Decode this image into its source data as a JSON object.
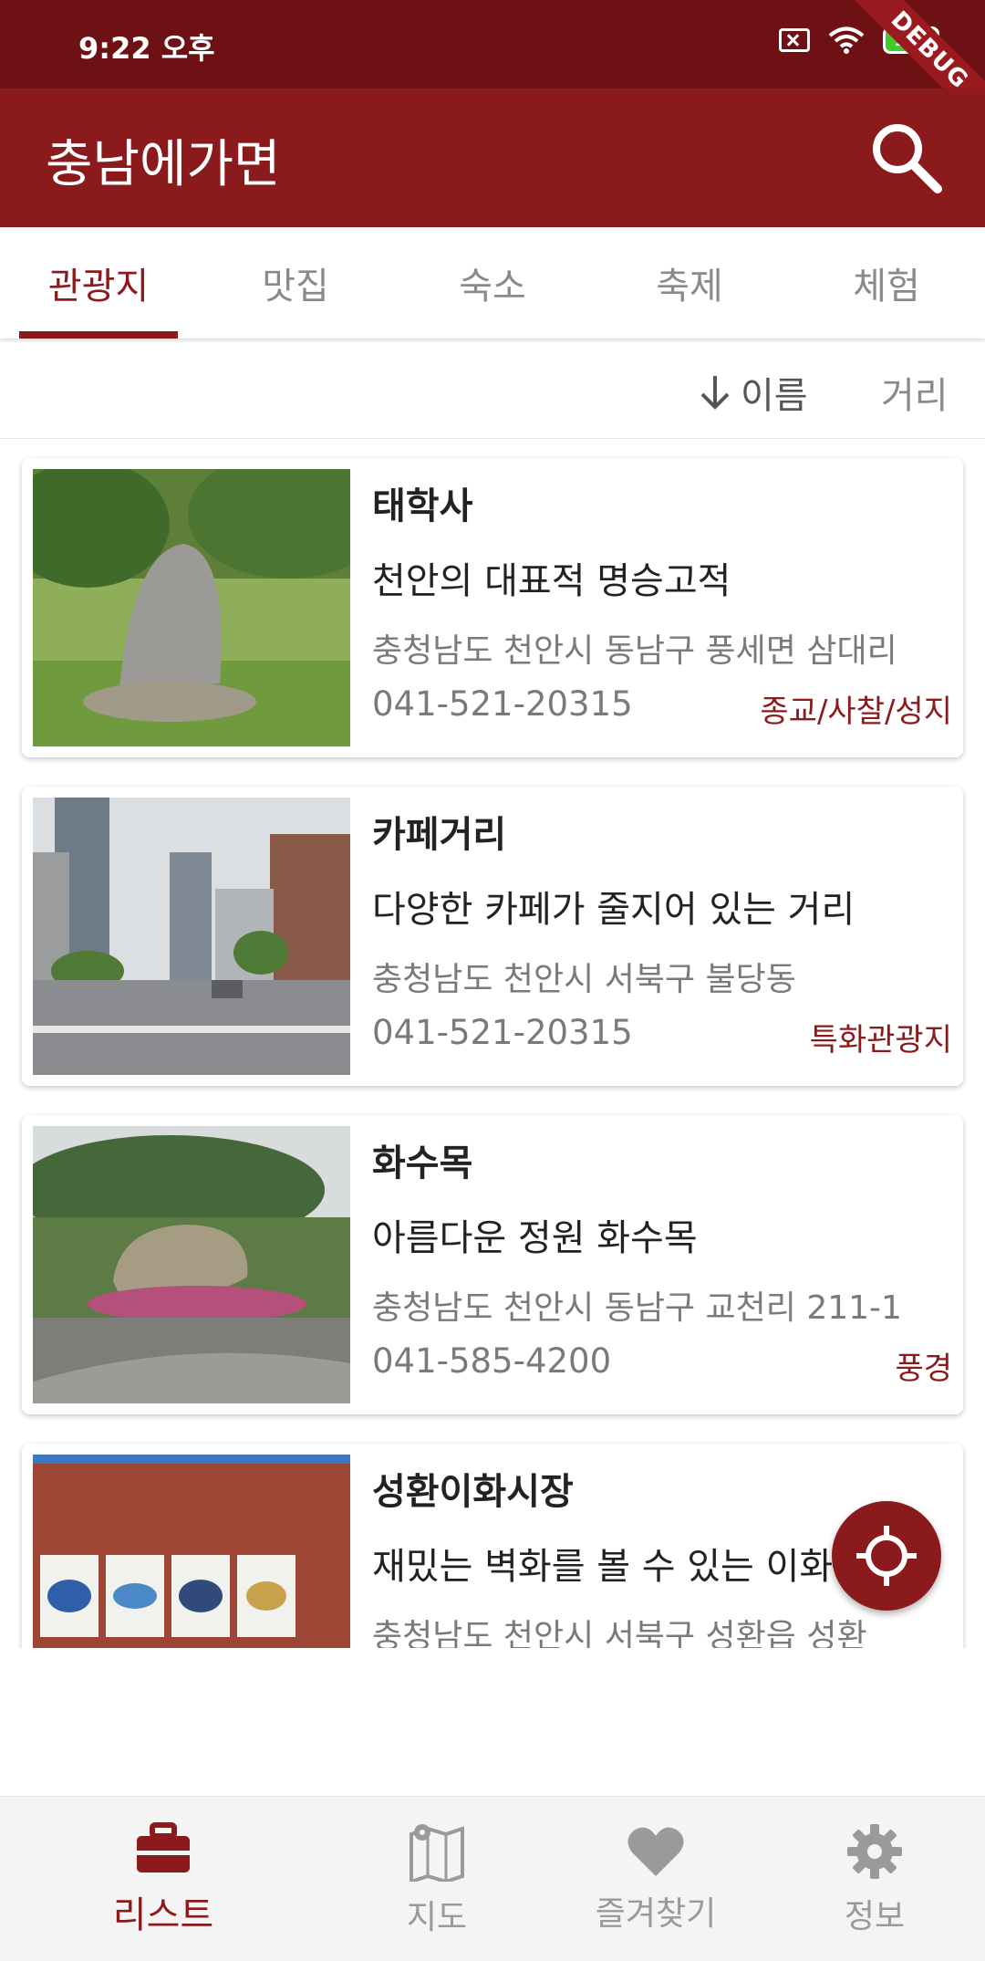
{
  "status": {
    "time": "9:22 오후",
    "battery": "100",
    "debug": "DEBUG"
  },
  "app": {
    "title": "충남에가면"
  },
  "tabs": [
    {
      "label": "관광지"
    },
    {
      "label": "맛집"
    },
    {
      "label": "숙소"
    },
    {
      "label": "축제"
    },
    {
      "label": "체험"
    }
  ],
  "sort": {
    "name_label": "이름",
    "distance_label": "거리"
  },
  "items": [
    {
      "title": "태학사",
      "subtitle": "천안의 대표적 명승고적",
      "address": "충청남도 천안시 동남구 풍세면 삼대리",
      "phone": "041-521-20315",
      "category": "종교/사찰/성지"
    },
    {
      "title": "카페거리",
      "subtitle": "다양한 카페가 줄지어 있는 거리",
      "address": "충청남도 천안시 서북구 불당동",
      "phone": "041-521-20315",
      "category": "특화관광지"
    },
    {
      "title": "화수목",
      "subtitle": "아름다운 정원 화수목",
      "address": "충청남도 천안시 동남구 교천리 211-1",
      "phone": "041-585-4200",
      "category": "풍경"
    },
    {
      "title": "성환이화시장",
      "subtitle": "재밌는 벽화를 볼 수 있는 이화시장",
      "address": "충청남도 천안시 서북구 성환읍 성환",
      "phone": "",
      "category": ""
    }
  ],
  "bottom_nav": [
    {
      "label": "리스트",
      "icon": "briefcase-icon"
    },
    {
      "label": "지도",
      "icon": "map-icon"
    },
    {
      "label": "즐겨찾기",
      "icon": "heart-icon"
    },
    {
      "label": "정보",
      "icon": "gear-icon"
    }
  ],
  "colors": {
    "primary": "#8b1a1d",
    "status_bar": "#6e1115",
    "inactive": "#9a9a9a"
  }
}
